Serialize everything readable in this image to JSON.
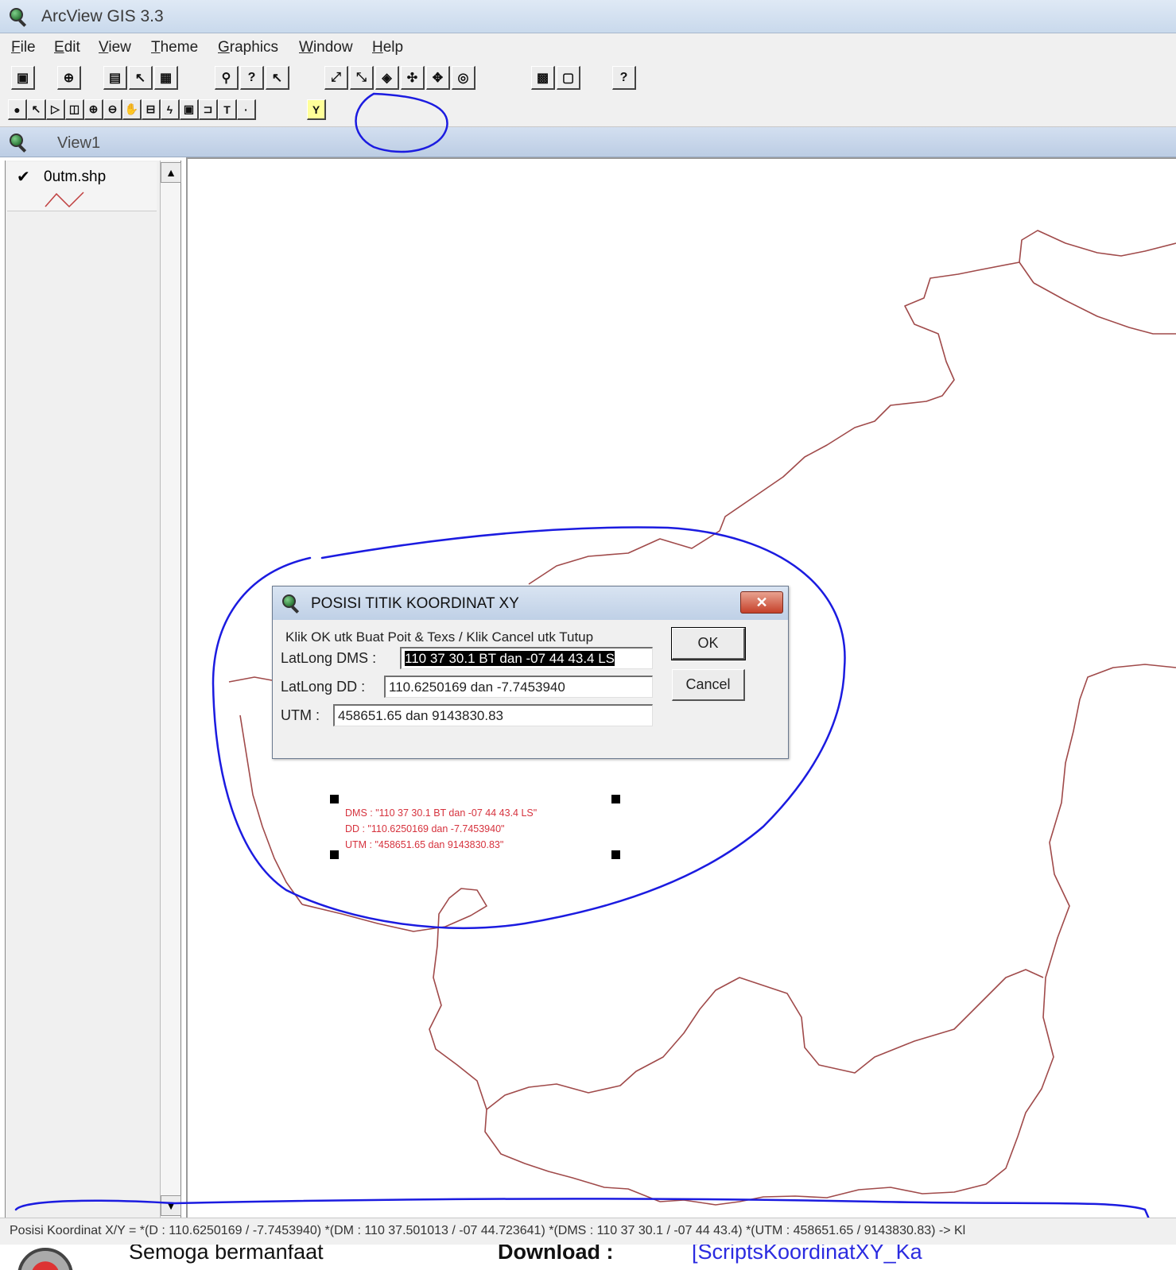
{
  "app": {
    "title": "ArcView GIS 3.3"
  },
  "menu": [
    {
      "label": "File",
      "ul": "F",
      "rest": "ile"
    },
    {
      "label": "Edit",
      "ul": "E",
      "rest": "dit"
    },
    {
      "label": "View",
      "ul": "V",
      "rest": "iew"
    },
    {
      "label": "Theme",
      "ul": "T",
      "rest": "heme"
    },
    {
      "label": "Graphics",
      "ul": "G",
      "rest": "raphics"
    },
    {
      "label": "Window",
      "ul": "W",
      "rest": "indow"
    },
    {
      "label": "Help",
      "ul": "H",
      "rest": "elp"
    }
  ],
  "toolbar": {
    "text_tool_glyph": "T"
  },
  "view": {
    "title": "View1"
  },
  "toc": {
    "layer_name": "0utm.shp",
    "layer_checked": true
  },
  "dialog": {
    "title": "POSISI TITIK KOORDINAT XY",
    "close_glyph": "✕",
    "message": "Klik OK utk Buat Poit & Texs / Klik Cancel utk Tutup",
    "fields": {
      "dms_label": "LatLong DMS :",
      "dms_value": "110 37 30.1 BT dan -07 44 43.4 LS",
      "dd_label": "LatLong DD :",
      "dd_value": "110.6250169 dan -7.7453940",
      "utm_label": "UTM :",
      "utm_value": "458651.65 dan 9143830.83"
    },
    "ok_label": "OK",
    "cancel_label": "Cancel"
  },
  "map_label": {
    "line1": "DMS : \"110 37 30.1 BT dan -07 44 43.4 LS\"",
    "line2": "DD : \"110.6250169 dan -7.7453940\"",
    "line3": "UTM : \"458651.65 dan 9143830.83\""
  },
  "statusbar": {
    "text": "Posisi Koordinat X/Y =  *(D : 110.6250169 / -7.7453940) *(DM : 110 37.501013 / -07 44.723641) *(DMS : 110 37 30.1 / -07 44 43.4) *(UTM : 458651.65 / 9143830.83) -> Kl"
  },
  "footer": {
    "text1": "Semoga bermanfaat",
    "text2": "Download :",
    "text3": "[ScriptsKoordinatXY_Ka"
  },
  "colors": {
    "map_line": "#a04a4a",
    "annotation": "#1b1be0",
    "label_text": "#d6333e"
  }
}
